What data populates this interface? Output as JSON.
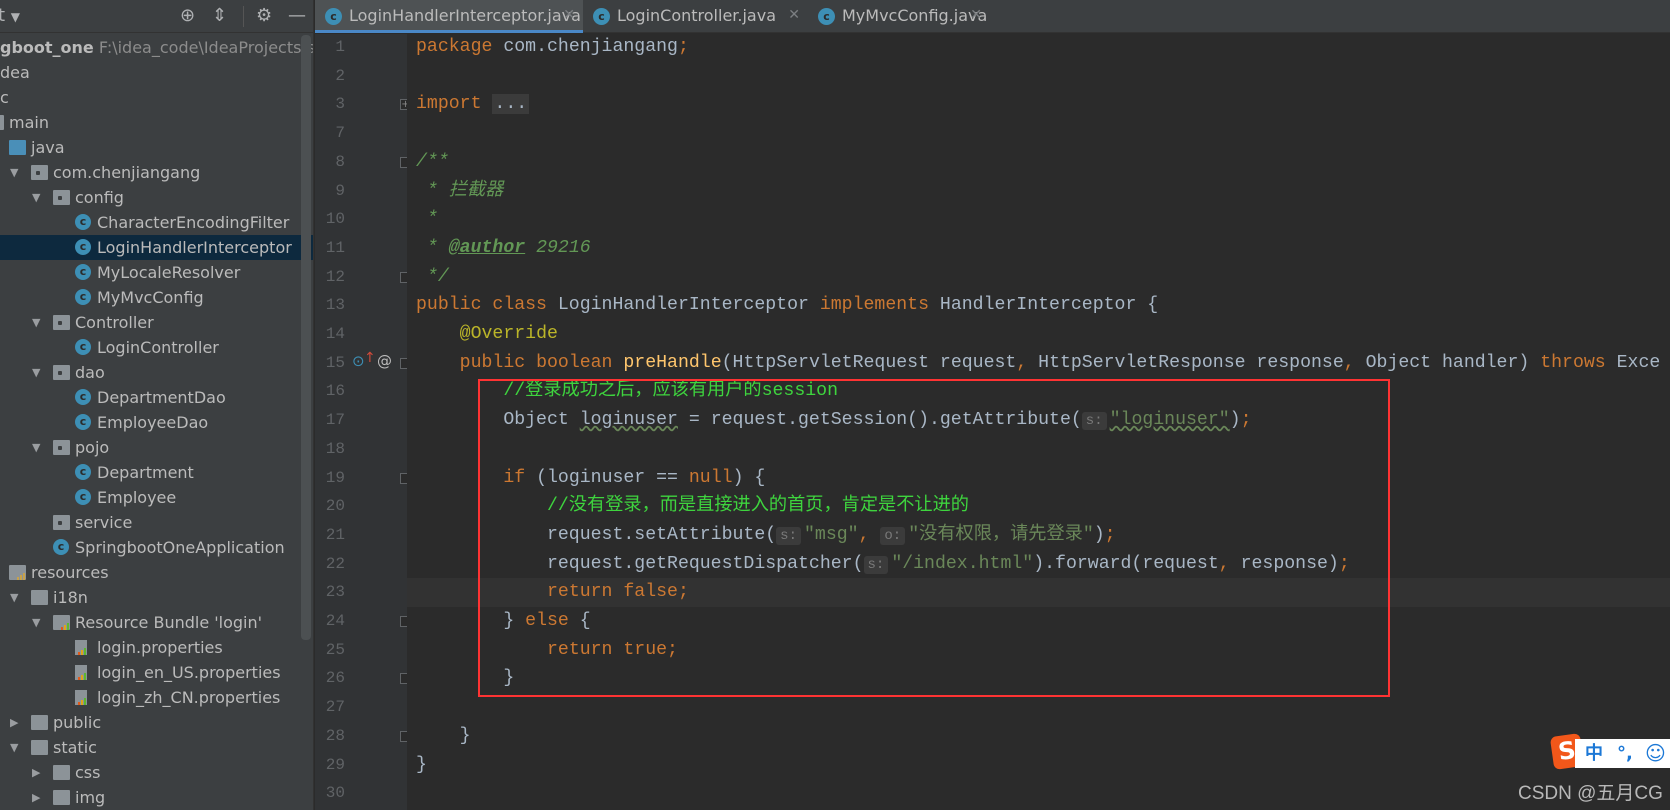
{
  "sidebar": {
    "header": {
      "partial_label": "t",
      "icons": [
        "crosshair-icon",
        "collapse-all-icon",
        "gear-icon",
        "minimize-icon"
      ]
    },
    "tree": [
      {
        "label": "gboot_one",
        "path": "F:\\idea_code\\IdeaProjects\\spri",
        "bold": true,
        "depth": -1
      },
      {
        "label": "dea",
        "depth": -1
      },
      {
        "label": "c",
        "depth": -1
      },
      {
        "label": "main",
        "depth": 0,
        "icon": "folder"
      },
      {
        "label": "java",
        "depth": 1,
        "icon": "source-folder"
      },
      {
        "label": "com.chenjiangang",
        "depth": 2,
        "icon": "package",
        "arrow": "down"
      },
      {
        "label": "config",
        "depth": 3,
        "icon": "package",
        "arrow": "down"
      },
      {
        "label": "CharacterEncodingFilter",
        "depth": 4,
        "icon": "class"
      },
      {
        "label": "LoginHandlerInterceptor",
        "depth": 4,
        "icon": "class",
        "selected": true
      },
      {
        "label": "MyLocaleResolver",
        "depth": 4,
        "icon": "class"
      },
      {
        "label": "MyMvcConfig",
        "depth": 4,
        "icon": "class"
      },
      {
        "label": "Controller",
        "depth": 3,
        "icon": "package",
        "arrow": "down"
      },
      {
        "label": "LoginController",
        "depth": 4,
        "icon": "class"
      },
      {
        "label": "dao",
        "depth": 3,
        "icon": "package",
        "arrow": "down"
      },
      {
        "label": "DepartmentDao",
        "depth": 4,
        "icon": "class"
      },
      {
        "label": "EmployeeDao",
        "depth": 4,
        "icon": "class"
      },
      {
        "label": "pojo",
        "depth": 3,
        "icon": "package",
        "arrow": "down"
      },
      {
        "label": "Department",
        "depth": 4,
        "icon": "class"
      },
      {
        "label": "Employee",
        "depth": 4,
        "icon": "class"
      },
      {
        "label": "service",
        "depth": 3,
        "icon": "package"
      },
      {
        "label": "SpringbootOneApplication",
        "depth": 3,
        "icon": "spring-boot-class"
      },
      {
        "label": "resources",
        "depth": 1,
        "icon": "resources-folder"
      },
      {
        "label": "i18n",
        "depth": 2,
        "icon": "folder",
        "arrow": "down"
      },
      {
        "label": "Resource Bundle 'login'",
        "depth": 3,
        "icon": "resource-bundle",
        "arrow": "down"
      },
      {
        "label": "login.properties",
        "depth": 4,
        "icon": "properties-file"
      },
      {
        "label": "login_en_US.properties",
        "depth": 4,
        "icon": "properties-file"
      },
      {
        "label": "login_zh_CN.properties",
        "depth": 4,
        "icon": "properties-file"
      },
      {
        "label": "public",
        "depth": 2,
        "icon": "folder",
        "arrow": "right"
      },
      {
        "label": "static",
        "depth": 2,
        "icon": "folder",
        "arrow": "down"
      },
      {
        "label": "css",
        "depth": 3,
        "icon": "folder",
        "arrow": "right"
      },
      {
        "label": "img",
        "depth": 3,
        "icon": "folder",
        "arrow": "right"
      }
    ]
  },
  "tabs": [
    {
      "label": "LoginHandlerInterceptor.java",
      "active": true,
      "closable": true
    },
    {
      "label": "LoginController.java",
      "closable": true
    },
    {
      "label": "MyMvcConfig.java",
      "closable": true
    }
  ],
  "editor": {
    "current_line": 23,
    "fold_lines": [
      3,
      8,
      12,
      15,
      19,
      24,
      26,
      28
    ],
    "gutter_marks": {
      "15": [
        "overrides-method-icon",
        "annotation-at-icon"
      ]
    },
    "lines": [
      {
        "n": 1,
        "t": [
          [
            "k",
            "package "
          ],
          [
            "p",
            "com.chenjiangang"
          ],
          [
            "k",
            ";"
          ]
        ]
      },
      {
        "n": 2,
        "t": []
      },
      {
        "n": 3,
        "t": [
          [
            "k",
            "import "
          ],
          [
            "fb",
            "..."
          ]
        ]
      },
      {
        "n": 7,
        "t": []
      },
      {
        "n": 8,
        "t": [
          [
            "dc",
            "/**"
          ]
        ]
      },
      {
        "n": 9,
        "t": [
          [
            "dc",
            " * 拦截器"
          ]
        ]
      },
      {
        "n": 10,
        "t": [
          [
            "dc",
            " *"
          ]
        ]
      },
      {
        "n": 11,
        "t": [
          [
            "dc",
            " * "
          ],
          [
            "dt",
            "@author"
          ],
          [
            "dc",
            " 29216"
          ]
        ]
      },
      {
        "n": 12,
        "t": [
          [
            "dc",
            " */"
          ]
        ]
      },
      {
        "n": 13,
        "t": [
          [
            "k",
            "public class "
          ],
          [
            "p",
            "LoginHandlerInterceptor "
          ],
          [
            "k",
            "implements "
          ],
          [
            "p",
            "HandlerInterceptor {"
          ]
        ]
      },
      {
        "n": 14,
        "t": [
          [
            "p",
            "    "
          ],
          [
            "an",
            "@Override"
          ]
        ]
      },
      {
        "n": 15,
        "t": [
          [
            "p",
            "    "
          ],
          [
            "k",
            "public boolean "
          ],
          [
            "fn",
            "preHandle"
          ],
          [
            "p",
            "(HttpServletRequest request"
          ],
          [
            "k",
            ","
          ],
          [
            "p",
            " HttpServletResponse response"
          ],
          [
            "k",
            ","
          ],
          [
            "p",
            " Object handler) "
          ],
          [
            "k",
            "throws "
          ],
          [
            "p",
            "Exce"
          ]
        ]
      },
      {
        "n": 16,
        "t": [
          [
            "p",
            "        "
          ],
          [
            "lc",
            "//登录成功之后，应该有用户的session"
          ]
        ]
      },
      {
        "n": 17,
        "t": [
          [
            "p",
            "        Object "
          ],
          [
            "sq",
            "loginuser"
          ],
          [
            "p",
            " = request.getSession().getAttribute("
          ],
          [
            "h",
            "s:"
          ],
          [
            "s sq",
            "\"loginuser\""
          ],
          [
            "p",
            ")"
          ],
          [
            "k",
            ";"
          ]
        ]
      },
      {
        "n": 18,
        "t": []
      },
      {
        "n": 19,
        "t": [
          [
            "p",
            "        "
          ],
          [
            "k",
            "if "
          ],
          [
            "p",
            "(loginuser == "
          ],
          [
            "k",
            "null"
          ],
          [
            "p",
            ") {"
          ]
        ]
      },
      {
        "n": 20,
        "t": [
          [
            "p",
            "            "
          ],
          [
            "lc",
            "//没有登录，而是直接进入的首页，肯定是不让进的"
          ]
        ]
      },
      {
        "n": 21,
        "t": [
          [
            "p",
            "            request.setAttribute("
          ],
          [
            "h",
            "s:"
          ],
          [
            "s",
            "\"msg\""
          ],
          [
            "k",
            ", "
          ],
          [
            "h",
            "o:"
          ],
          [
            "s",
            "\"没有权限，请先登录\""
          ],
          [
            "p",
            ")"
          ],
          [
            "k",
            ";"
          ]
        ]
      },
      {
        "n": 22,
        "t": [
          [
            "p",
            "            request.getRequestDispatcher("
          ],
          [
            "h",
            "s:"
          ],
          [
            "s",
            "\"/index.html\""
          ],
          [
            "p",
            ").forward(request"
          ],
          [
            "k",
            ","
          ],
          [
            "p",
            " response)"
          ],
          [
            "k",
            ";"
          ]
        ]
      },
      {
        "n": 23,
        "t": [
          [
            "p",
            "            "
          ],
          [
            "k",
            "return false;"
          ]
        ]
      },
      {
        "n": 24,
        "t": [
          [
            "p",
            "        } "
          ],
          [
            "k",
            "else "
          ],
          [
            "p",
            "{"
          ]
        ]
      },
      {
        "n": 25,
        "t": [
          [
            "p",
            "            "
          ],
          [
            "k",
            "return true;"
          ]
        ]
      },
      {
        "n": 26,
        "t": [
          [
            "p",
            "        }"
          ]
        ]
      },
      {
        "n": 27,
        "t": []
      },
      {
        "n": 28,
        "t": [
          [
            "p",
            "    }"
          ]
        ]
      },
      {
        "n": 29,
        "t": [
          [
            "p",
            "}"
          ]
        ]
      },
      {
        "n": 30,
        "t": []
      }
    ]
  },
  "annotation": {
    "highlight_color": "#ff3333"
  },
  "ime": {
    "logo": "S",
    "mode": "中",
    "punct": "°,",
    "emoji_icon": "smiley-icon"
  },
  "watermark": "CSDN @五月CG",
  "colors": {
    "accent": "#4a88c7",
    "keyword": "#cc7832",
    "string": "#6a8759",
    "comment": "#3ed43e",
    "doc": "#629755"
  }
}
